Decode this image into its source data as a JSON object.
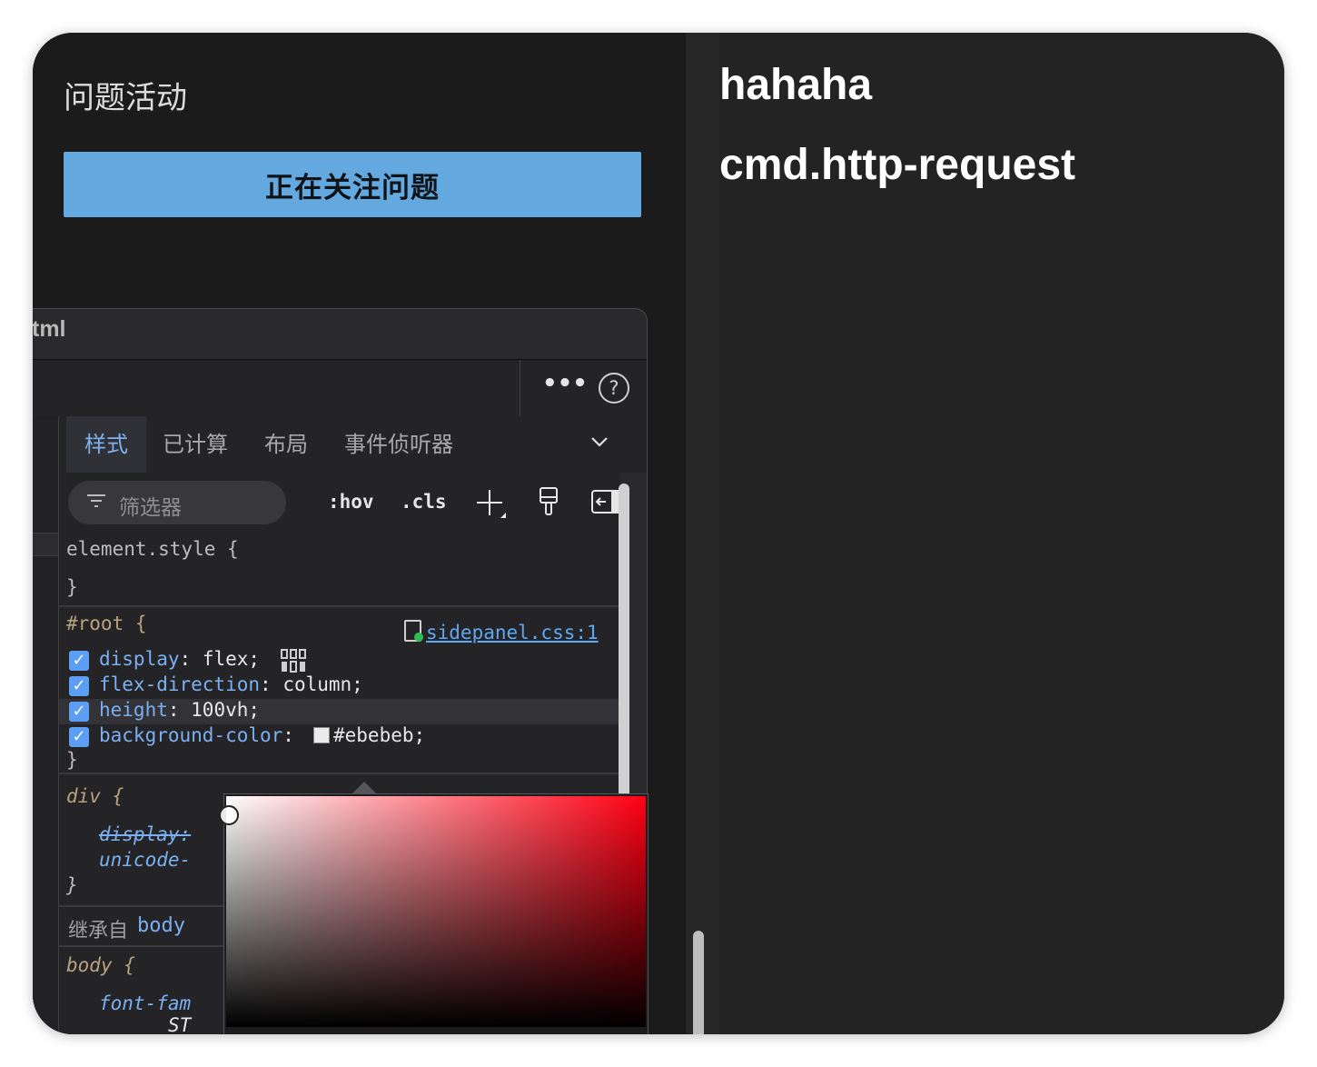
{
  "page": {
    "heading": "问题活动",
    "follow_button": "正在关注问题"
  },
  "devtools": {
    "title": "tml",
    "toolbar": {
      "more_icon": "more-horizontal-icon",
      "help_icon": "help-circle-icon"
    },
    "tabs": [
      {
        "label": "样式",
        "active": true
      },
      {
        "label": "已计算",
        "active": false
      },
      {
        "label": "布局",
        "active": false
      },
      {
        "label": "事件侦听器",
        "active": false
      }
    ],
    "filter": {
      "placeholder": "筛选器",
      "hov": ":hov",
      "cls": ".cls"
    },
    "rules": {
      "element_style": {
        "selector": "element.style {",
        "close": "}"
      },
      "root": {
        "selector": "#root {",
        "source": "sidepanel.css:1",
        "declarations": [
          {
            "prop": "display",
            "value": "flex;"
          },
          {
            "prop": "flex-direction",
            "value": "column;"
          },
          {
            "prop": "height",
            "value": "100vh;"
          },
          {
            "prop": "background-color",
            "value": "#ebebeb;"
          }
        ],
        "close": "}"
      },
      "div": {
        "selector": "div {",
        "declarations": [
          "display:",
          "unicode-"
        ],
        "close": "}"
      },
      "inherited": {
        "label": "继承自",
        "element": "body"
      },
      "body": {
        "selector": "body {",
        "declarations": [
          "font-fam",
          "ST"
        ]
      }
    },
    "color_picker": {
      "current_color": "#ebebeb",
      "hue_color": "#ff0013"
    }
  },
  "right_panel": {
    "line1": "hahaha",
    "line2": "cmd.http-request"
  },
  "colors": {
    "accent_button": "#63a9e0",
    "link": "#5fa8f5",
    "property": "#7ab0f2"
  }
}
